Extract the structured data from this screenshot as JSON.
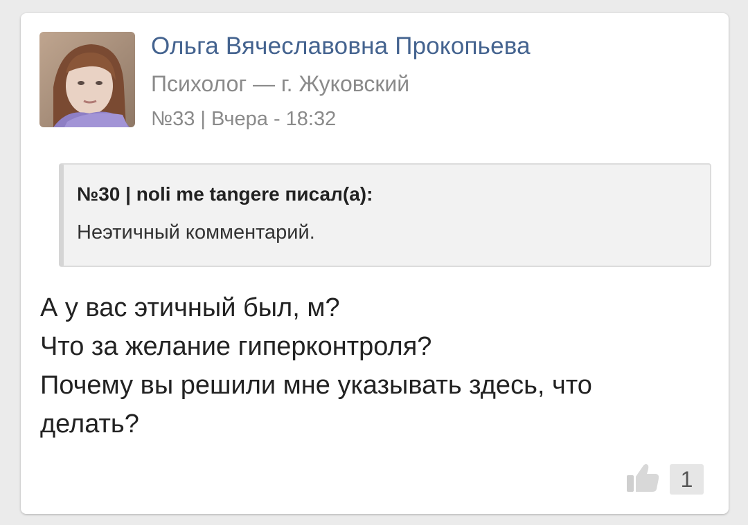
{
  "post": {
    "author_name": "Ольга Вячеславовна Прокопьева",
    "author_role": "Психолог — г. Жуковский",
    "meta": "№33 | Вчера - 18:32",
    "quote": {
      "header": "№30 | noli me tangere писал(а):",
      "text": "Неэтичный комментарий."
    },
    "body_lines": [
      "А у вас этичный был, м?",
      "Что за желание гиперконтроля?",
      "Почему вы решили мне указывать здесь, что",
      "делать?"
    ],
    "likes": {
      "icon": "thumbs-up-icon",
      "count": "1"
    }
  },
  "colors": {
    "author_link": "#44638f",
    "muted_text": "#8a8a8a",
    "quote_bg": "#f2f2f2",
    "page_bg": "#ebebeb"
  }
}
